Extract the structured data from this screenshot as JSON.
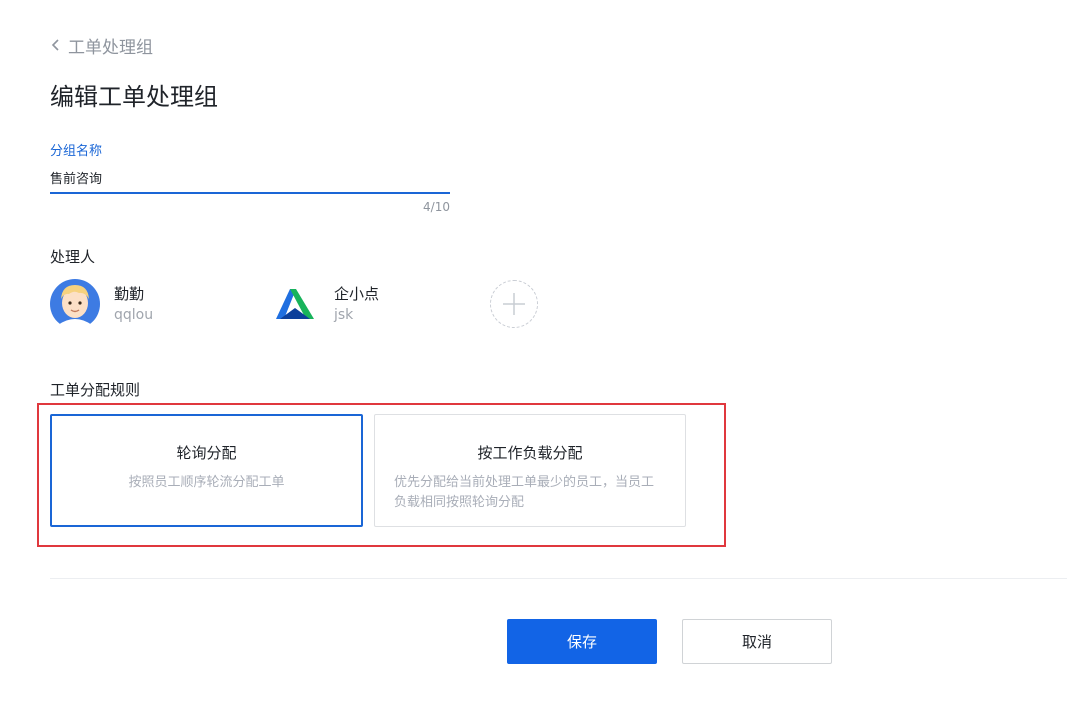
{
  "header": {
    "back_label": "工单处理组",
    "title": "编辑工单处理组"
  },
  "group_name": {
    "label": "分组名称",
    "value": "售前咨询",
    "count": "4/10"
  },
  "handlers": {
    "label": "处理人",
    "people": [
      {
        "name": "勤勤",
        "id": "qqlou"
      },
      {
        "name": "企小点",
        "id": "jsk"
      }
    ]
  },
  "rules": {
    "label": "工单分配规则",
    "options": [
      {
        "title": "轮询分配",
        "desc": "按照员工顺序轮流分配工单",
        "selected": true
      },
      {
        "title": "按工作负载分配",
        "desc": "优先分配给当前处理工单最少的员工，当员工负载相同按照轮询分配",
        "selected": false
      }
    ]
  },
  "actions": {
    "save_label": "保存",
    "cancel_label": "取消"
  },
  "colors": {
    "accent": "#1264e6",
    "label_blue": "#1a66d6",
    "highlight_red": "#e0383e"
  }
}
